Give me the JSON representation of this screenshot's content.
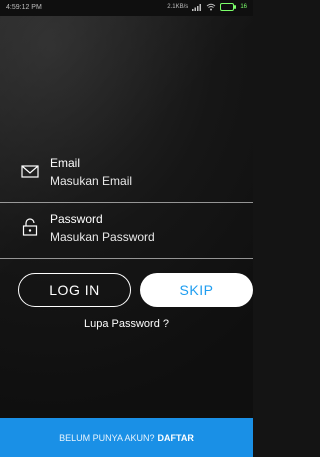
{
  "status_bar": {
    "time": "4:59:12 PM",
    "network": "2.1KB/s",
    "battery": "16"
  },
  "email": {
    "label": "Email",
    "placeholder": "Masukan Email",
    "icon": "envelope-icon"
  },
  "password": {
    "label": "Password",
    "placeholder": "Masukan Password",
    "icon": "lock-icon"
  },
  "buttons": {
    "login": "LOG IN",
    "skip": "SKIP"
  },
  "forgot_password": "Lupa Password ?",
  "footer": {
    "prompt": "BELUM PUNYA AKUN?",
    "action": "DAFTAR"
  },
  "colors": {
    "accent_blue": "#1a90e6",
    "skip_text_blue": "#1e9df0",
    "battery_green": "#7CFF6B"
  }
}
